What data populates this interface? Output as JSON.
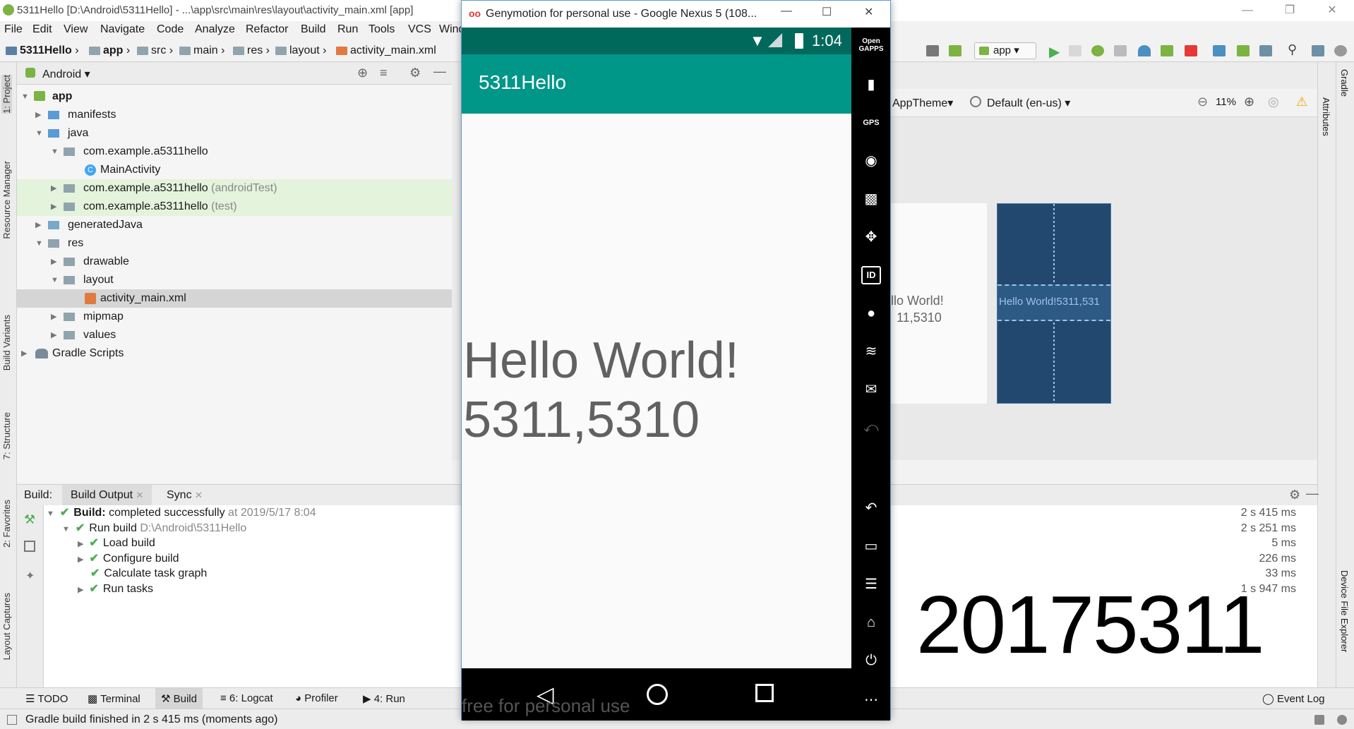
{
  "window": {
    "title": "5311Hello [D:\\Android\\5311Hello] - ...\\app\\src\\main\\res\\layout\\activity_main.xml [app]"
  },
  "menu": [
    "File",
    "Edit",
    "View",
    "Navigate",
    "Code",
    "Analyze",
    "Refactor",
    "Build",
    "Run",
    "Tools",
    "VCS",
    "Wind"
  ],
  "breadcrumb": [
    "5311Hello",
    "app",
    "src",
    "main",
    "res",
    "layout",
    "activity_main.xml"
  ],
  "toolbar": {
    "run_config": "app"
  },
  "left_strip": [
    "1: Project",
    "Resource Manager",
    "Build Variants",
    "7: Structure",
    "2: Favorites",
    "Layout Captures"
  ],
  "project": {
    "view_mode": "Android",
    "tree": [
      {
        "label": "app",
        "suffix": ""
      },
      {
        "label": "manifests",
        "suffix": ""
      },
      {
        "label": "java",
        "suffix": ""
      },
      {
        "label": "com.example.a5311hello",
        "suffix": ""
      },
      {
        "label": "MainActivity",
        "suffix": ""
      },
      {
        "label": "com.example.a5311hello",
        "suffix": "(androidTest)"
      },
      {
        "label": "com.example.a5311hello",
        "suffix": "(test)"
      },
      {
        "label": "generatedJava",
        "suffix": ""
      },
      {
        "label": "res",
        "suffix": ""
      },
      {
        "label": "drawable",
        "suffix": ""
      },
      {
        "label": "layout",
        "suffix": ""
      },
      {
        "label": "activity_main.xml",
        "suffix": ""
      },
      {
        "label": "mipmap",
        "suffix": ""
      },
      {
        "label": "values",
        "suffix": ""
      },
      {
        "label": "Gradle Scripts",
        "suffix": ""
      }
    ]
  },
  "designer": {
    "theme": "AppTheme",
    "locale": "Default (en-us)",
    "zoom": "11%",
    "preview_line1": "llo World!",
    "preview_line2": "11,5310",
    "blueprint_text": "Hello World!5311,531",
    "attributes_label": "Attributes",
    "gradle_label": "Gradle",
    "device_file_label": "Device File Explorer"
  },
  "build": {
    "label": "Build:",
    "tabs": [
      "Build Output",
      "Sync"
    ],
    "rows": [
      {
        "bold": "Build:",
        "text": " completed successfully",
        "muted": " at 2019/5/17 8:04",
        "time": "2 s 415 ms"
      },
      {
        "bold": "",
        "text": "Run build ",
        "muted": "D:\\Android\\5311Hello",
        "time": "2 s 251 ms"
      },
      {
        "bold": "",
        "text": "Load build",
        "muted": "",
        "time": "5 ms"
      },
      {
        "bold": "",
        "text": "Configure build",
        "muted": "",
        "time": "226 ms"
      },
      {
        "bold": "",
        "text": "Calculate task graph",
        "muted": "",
        "time": "33 ms"
      },
      {
        "bold": "",
        "text": "Run tasks",
        "muted": "",
        "time": "1 s 947 ms"
      }
    ],
    "overlay_number": "20175311"
  },
  "bottom_tabs": [
    "TODO",
    "Terminal",
    "Build",
    "6: Logcat",
    "Profiler",
    "4: Run"
  ],
  "event_log": "Event Log",
  "status": "Gradle build finished in 2 s 415 ms (moments ago)",
  "emulator": {
    "title": "Genymotion for personal use - Google Nexus 5 (108...",
    "clock": "1:04",
    "app_title": "5311Hello",
    "text_line1": "Hello World!",
    "text_line2": "5311,5310",
    "watermark": "free for personal use",
    "side_top_label": "Open GAPPS",
    "gps_label": "GPS",
    "id_label": "ID"
  },
  "colors": {
    "accent": "#009688",
    "statusbar": "#00695c",
    "blueprint": "#23486f",
    "success": "#4caf50"
  }
}
